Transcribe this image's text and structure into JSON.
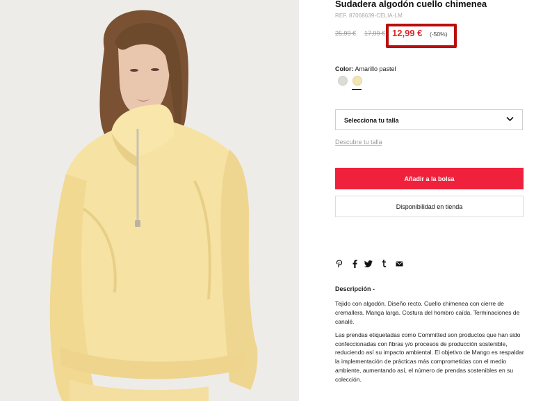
{
  "product": {
    "title": "Sudadera algodón cuello chimenea",
    "ref": "REF. 87068639-CELIA-LM",
    "price_original": "25,99 €",
    "price_previous": "17,99 €",
    "price_current": "12,99 €",
    "discount": "(-50%)",
    "color_label": "Color:",
    "color_value": "Amarillo pastel",
    "swatches": [
      {
        "name": "Gris claro",
        "hex": "#dcdcd6"
      },
      {
        "name": "Amarillo pastel",
        "hex": "#f3e4b6"
      }
    ],
    "highlight_color": "#b90e0e",
    "accent_color": "#f0213c"
  },
  "size": {
    "select_label": "Selecciona tu talla",
    "guide_link": "Descubre tu talla"
  },
  "actions": {
    "add_to_bag": "Añadir a la bolsa",
    "store_availability": "Disponibilidad en tienda"
  },
  "share": {
    "icons": [
      "pinterest-icon",
      "facebook-icon",
      "twitter-icon",
      "tumblr-icon",
      "email-icon"
    ],
    "glyphs": [
      "P",
      "f",
      "t",
      "t",
      "✉"
    ]
  },
  "description": {
    "title": "Descripción -",
    "paragraph1": "Tejido con algodón. Diseño recto. Cuello chimenea con cierre de cremallera. Manga larga. Costura del hombro caída. Terminaciones de canalé.",
    "paragraph2": "Las prendas etiquetadas como Committed son productos que han sido confeccionadas con fibras y/o procesos de producción sostenible, reduciendo así su impacto ambiental. El objetivo de Mango es respaldar la implementación de prácticas más comprometidas con el medio ambiente, aumentando así, el número de prendas sostenibles en su colección."
  }
}
